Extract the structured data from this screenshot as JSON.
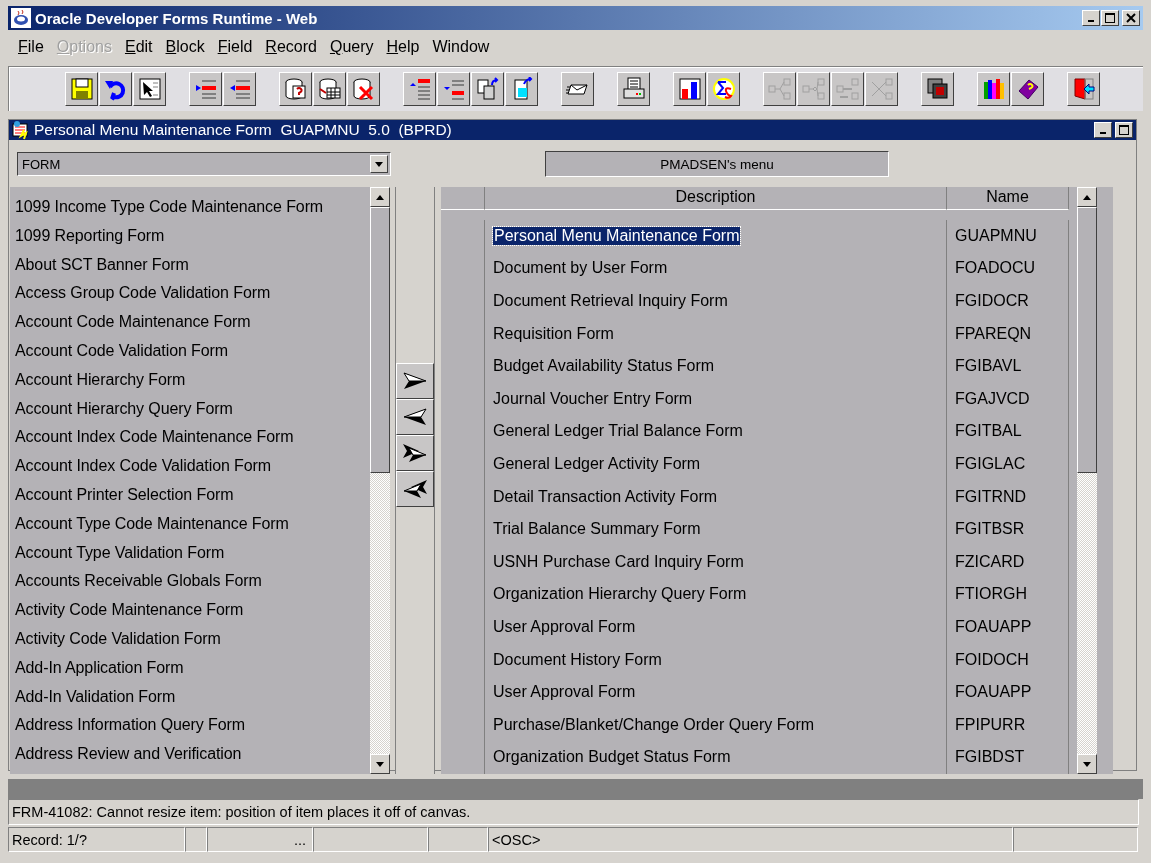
{
  "window": {
    "title": "Oracle Developer Forms Runtime - Web"
  },
  "menu": [
    {
      "label": "File",
      "underlined_initial": true,
      "disabled": false
    },
    {
      "label": "Options",
      "underlined_initial": true,
      "disabled": true
    },
    {
      "label": "Edit",
      "underlined_initial": true,
      "disabled": false
    },
    {
      "label": "Block",
      "underlined_initial": true,
      "disabled": false
    },
    {
      "label": "Field",
      "underlined_initial": true,
      "disabled": false
    },
    {
      "label": "Record",
      "underlined_initial": true,
      "disabled": false
    },
    {
      "label": "Query",
      "underlined_initial": true,
      "disabled": false
    },
    {
      "label": "Help",
      "underlined_initial": true,
      "disabled": false
    },
    {
      "label": "Window",
      "underlined_initial": false,
      "disabled": false
    }
  ],
  "toolbar": [
    [
      {
        "disabled": false
      },
      {
        "disabled": false
      },
      {
        "disabled": false
      }
    ],
    [
      {
        "disabled": false
      },
      {
        "disabled": false
      }
    ],
    [
      {
        "disabled": false
      },
      {
        "disabled": false
      },
      {
        "disabled": false
      }
    ],
    [
      {
        "disabled": false
      },
      {
        "disabled": false
      },
      {
        "disabled": false
      },
      {
        "disabled": false
      }
    ],
    [
      {
        "disabled": false
      }
    ],
    [
      {
        "disabled": false
      }
    ],
    [
      {
        "disabled": false
      },
      {
        "disabled": false
      }
    ],
    [
      {
        "disabled": true
      },
      {
        "disabled": true
      },
      {
        "disabled": true
      },
      {
        "disabled": true
      }
    ],
    [
      {
        "disabled": false
      }
    ],
    [
      {
        "disabled": false
      },
      {
        "disabled": false
      }
    ],
    [
      {
        "disabled": false
      }
    ]
  ],
  "form": {
    "title": "Personal Menu Maintenance Form  GUAPMNU  5.0  (BPRD)",
    "object_type": "FORM",
    "menu_title": "PMADSEN's menu",
    "available": [
      "1099 Income Type Code Maintenance Form",
      "1099 Reporting Form",
      "About SCT Banner Form",
      "Access Group Code Validation Form",
      "Account Code Maintenance Form",
      "Account Code Validation Form",
      "Account Hierarchy Form",
      "Account Hierarchy Query Form",
      "Account Index Code Maintenance Form",
      "Account Index Code Validation Form",
      "Account Printer Selection Form",
      "Account Type Code Maintenance Form",
      "Account Type Validation Form",
      "Accounts Receivable Globals Form",
      "Activity Code Maintenance Form",
      "Activity Code Validation Form",
      "Add-In Application Form",
      "Add-In Validation Form",
      "Address Information Query Form",
      "Address Review and Verification"
    ],
    "columns": [
      "Description",
      "Name"
    ],
    "rows": [
      {
        "description": "Personal Menu Maintenance Form",
        "name": "GUAPMNU",
        "selected": true
      },
      {
        "description": "Document by User Form",
        "name": "FOADOCU",
        "selected": false
      },
      {
        "description": "Document Retrieval Inquiry Form",
        "name": "FGIDOCR",
        "selected": false
      },
      {
        "description": "Requisition Form",
        "name": "FPAREQN",
        "selected": false
      },
      {
        "description": "Budget Availability Status Form",
        "name": "FGIBAVL",
        "selected": false
      },
      {
        "description": "Journal Voucher Entry Form",
        "name": "FGAJVCD",
        "selected": false
      },
      {
        "description": "General Ledger Trial Balance Form",
        "name": "FGITBAL",
        "selected": false
      },
      {
        "description": "General Ledger Activity Form",
        "name": "FGIGLAC",
        "selected": false
      },
      {
        "description": "Detail Transaction Activity Form",
        "name": "FGITRND",
        "selected": false
      },
      {
        "description": "Trial Balance Summary Form",
        "name": "FGITBSR",
        "selected": false
      },
      {
        "description": "USNH Purchase Card Inquiry Form",
        "name": "FZICARD",
        "selected": false
      },
      {
        "description": "Organization Hierarchy Query Form",
        "name": "FTIORGH",
        "selected": false
      },
      {
        "description": "User Approval Form",
        "name": "FOAUAPP",
        "selected": false
      },
      {
        "description": "Document History Form",
        "name": "FOIDOCH",
        "selected": false
      },
      {
        "description": "User Approval Form",
        "name": "FOAUAPP",
        "selected": false
      },
      {
        "description": "Purchase/Blanket/Change Order Query Form",
        "name": "FPIPURR",
        "selected": false
      },
      {
        "description": "Organization Budget Status Form",
        "name": "FGIBDST",
        "selected": false
      }
    ]
  },
  "message": "FRM-41082: Cannot resize item: position of item places it off of canvas.",
  "status_bar": {
    "record": "Record: 1/?",
    "ellipsis": "...",
    "mode": "<OSC>"
  }
}
